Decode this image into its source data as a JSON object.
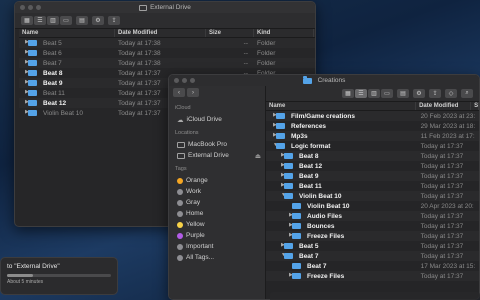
{
  "back_window": {
    "title": "External Drive",
    "columns": [
      "Name",
      "Date Modified",
      "Size",
      "Kind"
    ],
    "rows": [
      {
        "name": "Beat 5",
        "date": "Today at 17:38",
        "size": "--",
        "kind": "Folder",
        "dim": true
      },
      {
        "name": "Beat 6",
        "date": "Today at 17:38",
        "size": "--",
        "kind": "Folder",
        "dim": true
      },
      {
        "name": "Beat 7",
        "date": "Today at 17:38",
        "size": "--",
        "kind": "Folder",
        "dim": true
      },
      {
        "name": "Beat 8",
        "date": "Today at 17:37",
        "size": "--",
        "kind": "Folder",
        "dim": false
      },
      {
        "name": "Beat 9",
        "date": "Today at 17:37",
        "size": "--",
        "kind": "Folder",
        "dim": false
      },
      {
        "name": "Beat 11",
        "date": "Today at 17:37",
        "size": "--",
        "kind": "Folder",
        "dim": true
      },
      {
        "name": "Beat 12",
        "date": "Today at 17:37",
        "size": "--",
        "kind": "Folder",
        "dim": false
      },
      {
        "name": "Violin Beat 10",
        "date": "Today at 17:37",
        "size": "--",
        "kind": "Folder",
        "dim": true
      }
    ]
  },
  "dialog": {
    "title": "to \"External Drive\"",
    "subtitle": "About 5 minutes",
    "progress": 0.25
  },
  "front_window": {
    "title": "Creations",
    "sidebar": {
      "icloud_header": "iCloud",
      "icloud_drive": "iCloud Drive",
      "locations_header": "Locations",
      "locations": [
        "MacBook Pro",
        "External Drive"
      ],
      "tags_header": "Tags",
      "tags": [
        {
          "label": "Orange",
          "color": "#f5a623"
        },
        {
          "label": "Work",
          "color": "#8e8e93"
        },
        {
          "label": "Gray",
          "color": "#8e8e93"
        },
        {
          "label": "Home",
          "color": "#8e8e93"
        },
        {
          "label": "Yellow",
          "color": "#f8d248"
        },
        {
          "label": "Purple",
          "color": "#b25ce6"
        },
        {
          "label": "Important",
          "color": "#8e8e93"
        },
        {
          "label": "All Tags...",
          "color": "#8e8e93"
        }
      ]
    },
    "columns": [
      "Name",
      "Date Modified",
      "Size"
    ],
    "rows": [
      {
        "indent": 0,
        "arrow": "▶",
        "name": "Film/Game creations",
        "date": "20 Feb 2023 at 23:",
        "open": false
      },
      {
        "indent": 0,
        "arrow": "▶",
        "name": "References",
        "date": "29 Mar 2023 at 18:",
        "open": false
      },
      {
        "indent": 0,
        "arrow": "▶",
        "name": "Mp3s",
        "date": "11 Feb 2023 at 17:",
        "open": false
      },
      {
        "indent": 0,
        "arrow": "▼",
        "name": "Logic format",
        "date": "Today at 17:37",
        "open": true
      },
      {
        "indent": 1,
        "arrow": "▶",
        "name": "Beat 8",
        "date": "Today at 17:37",
        "open": false
      },
      {
        "indent": 1,
        "arrow": "▶",
        "name": "Beat 12",
        "date": "Today at 17:37",
        "open": false
      },
      {
        "indent": 1,
        "arrow": "▶",
        "name": "Beat 9",
        "date": "Today at 17:37",
        "open": false
      },
      {
        "indent": 1,
        "arrow": "▶",
        "name": "Beat 11",
        "date": "Today at 17:37",
        "open": false
      },
      {
        "indent": 1,
        "arrow": "▼",
        "name": "Violin Beat 10",
        "date": "Today at 17:37",
        "open": true
      },
      {
        "indent": 2,
        "arrow": "",
        "name": "Violin Beat 10",
        "date": "20 Apr 2023 at 20:",
        "open": false
      },
      {
        "indent": 2,
        "arrow": "▶",
        "name": "Audio Files",
        "date": "Today at 17:37",
        "open": false
      },
      {
        "indent": 2,
        "arrow": "▶",
        "name": "Bounces",
        "date": "Today at 17:37",
        "open": false
      },
      {
        "indent": 2,
        "arrow": "▶",
        "name": "Freeze Files",
        "date": "Today at 17:37",
        "open": false
      },
      {
        "indent": 1,
        "arrow": "▶",
        "name": "Beat 5",
        "date": "Today at 17:37",
        "open": false
      },
      {
        "indent": 1,
        "arrow": "▼",
        "name": "Beat 7",
        "date": "Today at 17:37",
        "open": true
      },
      {
        "indent": 2,
        "arrow": "",
        "name": "Beat 7",
        "date": "17 Mar 2023 at 15:",
        "open": false
      },
      {
        "indent": 2,
        "arrow": "▶",
        "name": "Freeze Files",
        "date": "Today at 17:37",
        "open": false
      }
    ]
  }
}
